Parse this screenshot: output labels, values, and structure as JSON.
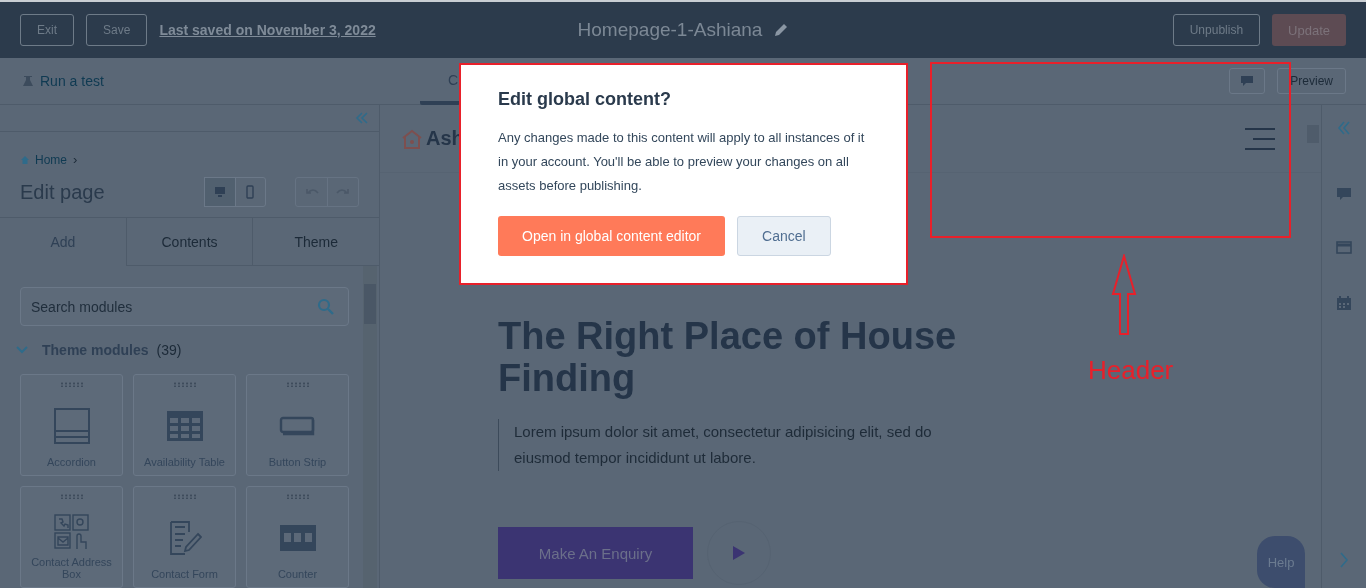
{
  "top_bar": {
    "buttons": [
      "Exit",
      "Save"
    ],
    "last_saved": "Last saved on November 3, 2022",
    "page_title": "Homepage-1-Ashiana",
    "unpublish": "Unpublish",
    "update": "Update"
  },
  "toolbar": {
    "run_test": "Run a test",
    "tabs": [
      {
        "label": "C",
        "selected": true
      }
    ],
    "preview": "Preview"
  },
  "sidebar": {
    "breadcrumb": "Home",
    "breadcrumb_separator": "›",
    "title": "Edit page",
    "view_modes": [
      {
        "kind": "desktop",
        "selected": true
      },
      {
        "kind": "mobile",
        "selected": false
      }
    ],
    "tabs": [
      {
        "label": "Add",
        "selected": true
      },
      {
        "label": "Contents",
        "selected": false
      },
      {
        "label": "Theme",
        "selected": false
      }
    ],
    "search": {
      "placeholder": "Search modules"
    },
    "section": {
      "title": "Theme modules",
      "count": "(39)",
      "expanded": true
    },
    "modules": [
      {
        "kind": "accordion",
        "label": "Accordion"
      },
      {
        "kind": "table",
        "label": "Availability Table"
      },
      {
        "kind": "button-strip",
        "label": "Button Strip"
      },
      {
        "kind": "contact",
        "label": "Contact Address Box"
      },
      {
        "kind": "form",
        "label": "Contact Form"
      },
      {
        "kind": "counter",
        "label": "Counter"
      }
    ]
  },
  "canvas": {
    "logo": "Ash",
    "heading": "The Right Place of House Finding",
    "text": "Lorem ipsum dolor sit amet, consectetur adipisicing elit, sed do eiusmod tempor incididunt ut labore.",
    "cta": "Make An Enquiry"
  },
  "modal": {
    "title": "Edit global content?",
    "body": "Any changes made to this content will apply to all instances of it in your account. You'll be able to preview your changes on all assets before publishing.",
    "primary": "Open in global content editor",
    "cancel": "Cancel"
  },
  "annotation": {
    "label": "Header"
  },
  "help": "Help"
}
